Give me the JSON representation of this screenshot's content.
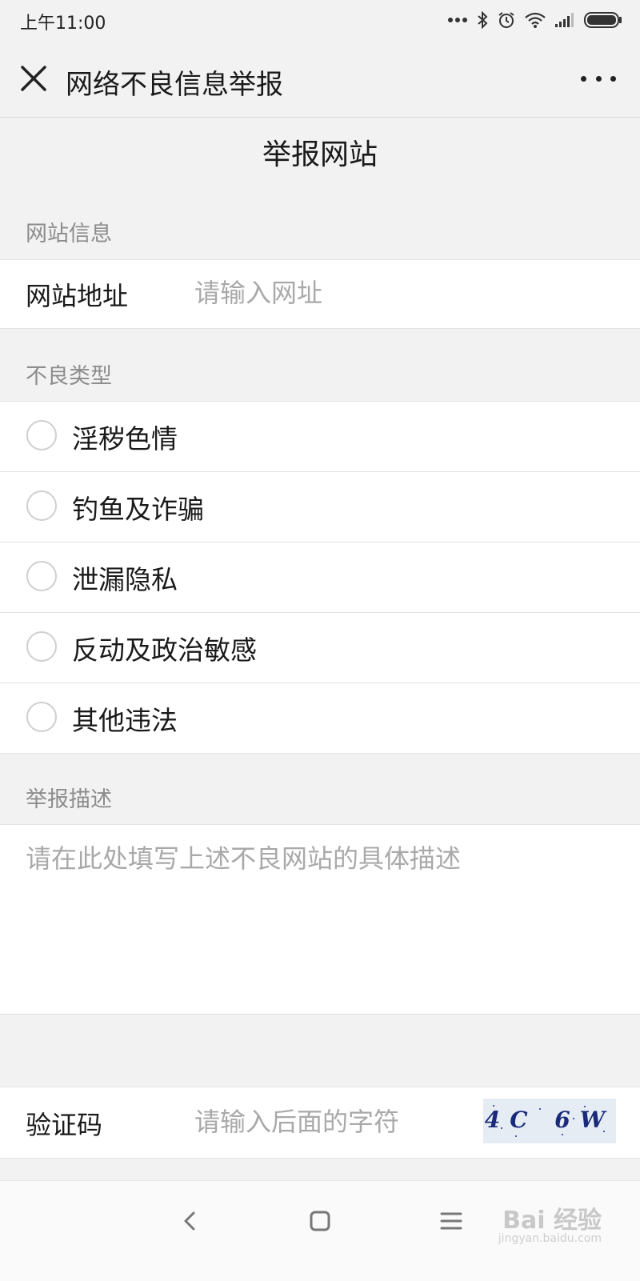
{
  "status_bar": {
    "time": "上午11:00",
    "icons": [
      "more-dots-icon",
      "bluetooth-icon",
      "alarm-icon",
      "wifi-icon",
      "signal-icon",
      "battery-icon"
    ]
  },
  "nav": {
    "title": "网络不良信息举报",
    "close_icon": "close-icon",
    "more_icon": "more-icon"
  },
  "page": {
    "title": "举报网站"
  },
  "site_info": {
    "section_label": "网站信息",
    "url_label": "网站地址",
    "url_placeholder": "请输入网址",
    "url_value": ""
  },
  "bad_type": {
    "section_label": "不良类型",
    "options": [
      {
        "label": "淫秽色情",
        "selected": false
      },
      {
        "label": "钓鱼及诈骗",
        "selected": false
      },
      {
        "label": "泄漏隐私",
        "selected": false
      },
      {
        "label": "反动及政治敏感",
        "selected": false
      },
      {
        "label": "其他违法",
        "selected": false
      }
    ]
  },
  "description": {
    "section_label": "举报描述",
    "placeholder": "请在此处填写上述不良网站的具体描述",
    "value": ""
  },
  "captcha": {
    "label": "验证码",
    "placeholder": "请输入后面的字符",
    "value": "",
    "image_text": "4C 6W"
  },
  "bottom_nav": {
    "buttons": [
      "back-icon",
      "home-icon",
      "menu-icon"
    ]
  },
  "watermark": {
    "text": "Bai 经验",
    "sub": "jingyan.baidu.com"
  },
  "colors": {
    "background": "#f2f2f2",
    "panel": "#ffffff",
    "placeholder": "#a9a9a9",
    "section_label": "#8c8c8c"
  }
}
